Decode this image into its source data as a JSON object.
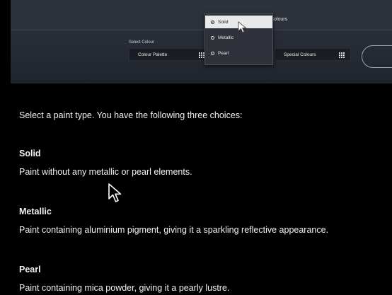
{
  "panel": {
    "special_colours_heading_partial": "Colours",
    "select_colour_label": "Select Colour",
    "colour_palette_button": "Colour Palette",
    "special_colours_button": "Special Colours",
    "paint_type_options": [
      {
        "label": "Solid",
        "selected": true
      },
      {
        "label": "Metallic",
        "selected": false
      },
      {
        "label": "Pearl",
        "selected": false
      }
    ]
  },
  "content": {
    "intro": "Select a paint type. You have the following three choices:",
    "types": [
      {
        "name": "Solid",
        "description": "Paint without any metallic or pearl elements."
      },
      {
        "name": "Metallic",
        "description": "Paint containing aluminium pigment, giving it a sparkling reflective appearance."
      },
      {
        "name": "Pearl",
        "description": "Paint containing mica powder, giving it a pearly lustre."
      }
    ]
  },
  "icons": {
    "grid": "grid-icon",
    "cursor": "mouse-cursor-icon"
  }
}
